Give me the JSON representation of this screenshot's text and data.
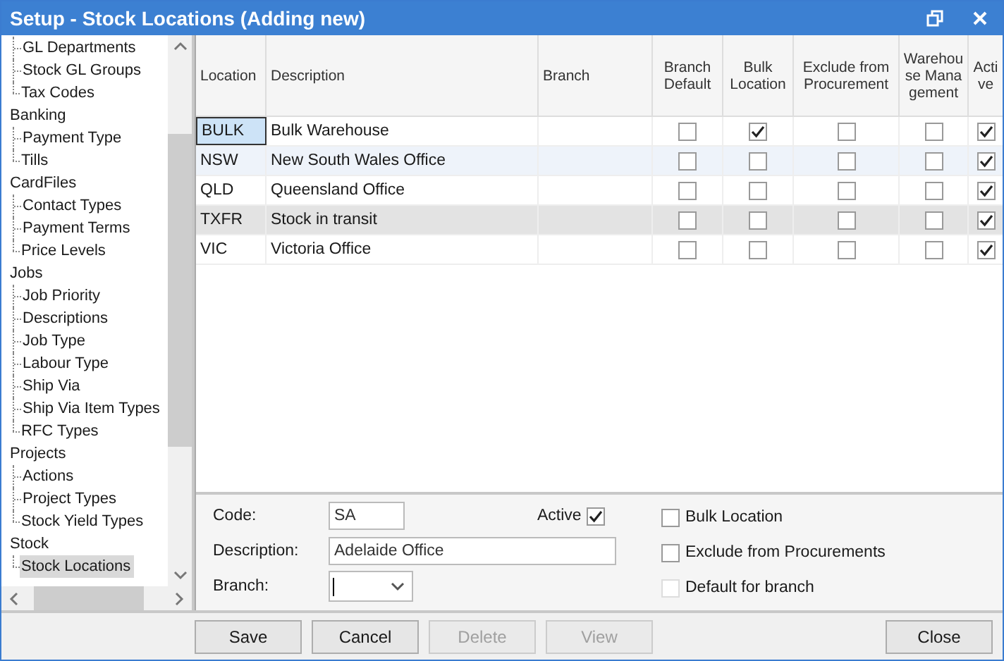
{
  "window": {
    "title": "Setup - Stock Locations (Adding new)"
  },
  "tree": [
    {
      "children": [
        {
          "label": "GL Departments",
          "selected": false
        },
        {
          "label": "Stock GL Groups",
          "selected": false
        },
        {
          "label": "Tax Codes",
          "selected": false
        }
      ]
    },
    {
      "label": "Banking",
      "children": [
        {
          "label": "Payment Type",
          "selected": false
        },
        {
          "label": "Tills",
          "selected": false
        }
      ]
    },
    {
      "label": "CardFiles",
      "children": [
        {
          "label": "Contact Types",
          "selected": false
        },
        {
          "label": "Payment Terms",
          "selected": false
        },
        {
          "label": "Price Levels",
          "selected": false
        }
      ]
    },
    {
      "label": "Jobs",
      "children": [
        {
          "label": "Job Priority",
          "selected": false
        },
        {
          "label": "Descriptions",
          "selected": false
        },
        {
          "label": "Job Type",
          "selected": false
        },
        {
          "label": "Labour Type",
          "selected": false
        },
        {
          "label": "Ship Via",
          "selected": false
        },
        {
          "label": "Ship Via Item Types",
          "selected": false
        },
        {
          "label": "RFC Types",
          "selected": false
        }
      ]
    },
    {
      "label": "Projects",
      "children": [
        {
          "label": "Actions",
          "selected": false
        },
        {
          "label": "Project Types",
          "selected": false
        },
        {
          "label": "Stock Yield Types",
          "selected": false
        }
      ]
    },
    {
      "label": "Stock",
      "children": [
        {
          "label": "Stock Locations",
          "selected": true
        }
      ]
    }
  ],
  "table": {
    "columns": [
      "Location",
      "Description",
      "Branch",
      "Branch Default",
      "Bulk Location",
      "Exclude from Procurement",
      "Warehouse Management",
      "Active"
    ],
    "rows": [
      {
        "location": "BULK",
        "description": "Bulk Warehouse",
        "branch_default": false,
        "bulk_location": true,
        "exclude": false,
        "warehouse": false,
        "active": true,
        "selected": false,
        "focused": true
      },
      {
        "location": "NSW",
        "description": "New South Wales Office",
        "branch_default": false,
        "bulk_location": false,
        "exclude": false,
        "warehouse": false,
        "active": true,
        "selected": false,
        "focused": false
      },
      {
        "location": "QLD",
        "description": "Queensland Office",
        "branch_default": false,
        "bulk_location": false,
        "exclude": false,
        "warehouse": false,
        "active": true,
        "selected": false,
        "focused": false
      },
      {
        "location": "TXFR",
        "description": "Stock in transit",
        "branch_default": false,
        "bulk_location": false,
        "exclude": false,
        "warehouse": false,
        "active": true,
        "selected": true,
        "focused": false
      },
      {
        "location": "VIC",
        "description": "Victoria Office",
        "branch_default": false,
        "bulk_location": false,
        "exclude": false,
        "warehouse": false,
        "active": true,
        "selected": false,
        "focused": false
      }
    ]
  },
  "form": {
    "code_label": "Code:",
    "code": "SA",
    "description_label": "Description:",
    "description": "Adelaide Office",
    "branch_label": "Branch:",
    "active": {
      "label": "Active",
      "checked": true
    },
    "options": [
      {
        "label": "Bulk Location",
        "checked": false,
        "disabled": false
      },
      {
        "label": "Exclude from Procurements",
        "checked": false,
        "disabled": false
      },
      {
        "label": "Default for branch",
        "checked": false,
        "disabled": true
      }
    ]
  },
  "buttons": [
    {
      "label": "Save",
      "disabled": false
    },
    {
      "label": "Cancel",
      "disabled": false
    },
    {
      "label": "Delete",
      "disabled": true
    },
    {
      "label": "View",
      "disabled": true
    }
  ],
  "close_button": {
    "label": "Close",
    "disabled": false
  }
}
